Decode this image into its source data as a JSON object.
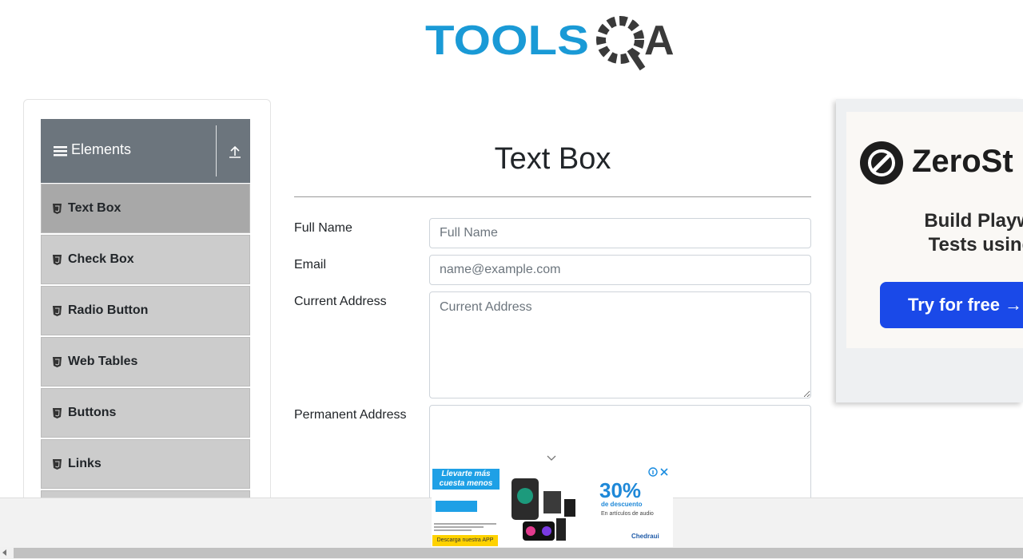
{
  "header": {
    "logo_text": "TOOLSQA"
  },
  "sidebar": {
    "group_title": "Elements",
    "items": [
      {
        "label": "Text Box",
        "active": true
      },
      {
        "label": "Check Box"
      },
      {
        "label": "Radio Button"
      },
      {
        "label": "Web Tables"
      },
      {
        "label": "Buttons"
      },
      {
        "label": "Links"
      }
    ]
  },
  "main": {
    "title": "Text Box",
    "fields": {
      "full_name": {
        "label": "Full Name",
        "placeholder": "Full Name",
        "value": ""
      },
      "email": {
        "label": "Email",
        "placeholder": "name@example.com",
        "value": ""
      },
      "current_address": {
        "label": "Current Address",
        "placeholder": "Current Address",
        "value": ""
      },
      "permanent_address": {
        "label": "Permanent Address",
        "placeholder": "",
        "value": ""
      }
    }
  },
  "ad_right": {
    "brand": "ZeroSt",
    "line1": "Build Playwrig",
    "line2": "Tests using A",
    "cta": "Try for free →"
  },
  "ad_bottom": {
    "headline": "Llevarte más cuesta menos",
    "percent": "30%",
    "discount": "de descuento",
    "sub": "En artículos de audio",
    "app": "Descarga nuestra APP",
    "brand": "Chedraui"
  },
  "colors": {
    "logo_blue": "#1a9ad6",
    "logo_dark": "#3a3a3a",
    "header_gray": "#6c757d",
    "menu_item": "#cccccc",
    "menu_active": "#a8a8a8",
    "cta_blue": "#1a49e8"
  }
}
